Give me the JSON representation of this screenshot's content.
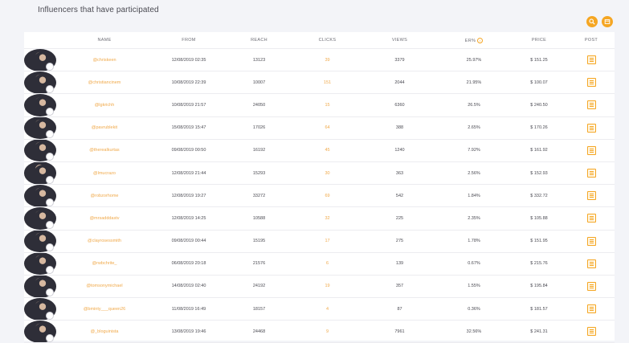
{
  "page": {
    "title": "Influencers that have participated"
  },
  "actions": {
    "search_icon": "search-icon",
    "export_icon": "export-icon"
  },
  "colors": {
    "accent": "#f5a623",
    "link": "#f0a94a",
    "background": "#f3f4f8"
  },
  "table": {
    "headers": {
      "name": "NAME",
      "from": "FROM",
      "reach": "REACH",
      "clicks": "CLICKS",
      "views": "VIEWS",
      "er": "ER%",
      "price": "PRICE",
      "post": "POST"
    },
    "rows": [
      {
        "handle": "@chriskeen",
        "from": "12/08/2019 02:35",
        "reach": "13123",
        "clicks": "39",
        "views": "3379",
        "er": "25.97%",
        "price": "$ 151.25"
      },
      {
        "handle": "@christiancinem",
        "from": "10/08/2019 22:39",
        "reach": "10007",
        "clicks": "151",
        "views": "2044",
        "er": "21.95%",
        "price": "$ 100.07"
      },
      {
        "handle": "@lgkrichh",
        "from": "10/08/2019 21:57",
        "reach": "24050",
        "clicks": "15",
        "views": "6360",
        "er": "26.5%",
        "price": "$ 240.50"
      },
      {
        "handle": "@pavrublekit",
        "from": "15/08/2019 15:47",
        "reach": "17026",
        "clicks": "64",
        "views": "388",
        "er": "2.65%",
        "price": "$ 170.26"
      },
      {
        "handle": "@therealkurtas",
        "from": "09/08/2019 00:50",
        "reach": "16192",
        "clicks": "45",
        "views": "1240",
        "er": "7.92%",
        "price": "$ 161.92"
      },
      {
        "handle": "@lmucrazo",
        "from": "12/08/2019 21:44",
        "reach": "15293",
        "clicks": "30",
        "views": "363",
        "er": "2.56%",
        "price": "$ 152.93"
      },
      {
        "handle": "@robzorhome",
        "from": "12/08/2019 19:27",
        "reach": "33272",
        "clicks": "69",
        "views": "542",
        "er": "1.84%",
        "price": "$ 332.72"
      },
      {
        "handle": "@mrsadddastv",
        "from": "12/08/2019 14:25",
        "reach": "10588",
        "clicks": "32",
        "views": "225",
        "er": "2.35%",
        "price": "$ 105.88"
      },
      {
        "handle": "@clayrosessmith",
        "from": "09/08/2019 00:44",
        "reach": "15195",
        "clicks": "17",
        "views": "275",
        "er": "1.78%",
        "price": "$ 151.95"
      },
      {
        "handle": "@rwbchrite_",
        "from": "06/08/2019 20:18",
        "reach": "21576",
        "clicks": "6",
        "views": "139",
        "er": "0.67%",
        "price": "$ 215.76"
      },
      {
        "handle": "@tomsonymichael",
        "from": "14/08/2019 02:40",
        "reach": "24192",
        "clicks": "19",
        "views": "357",
        "er": "1.55%",
        "price": "$ 195.84"
      },
      {
        "handle": "@bminty___queen26",
        "from": "11/08/2019 16:49",
        "reach": "18157",
        "clicks": "4",
        "views": "87",
        "er": "0.36%",
        "price": "$ 181.57"
      },
      {
        "handle": "@_bloguinista",
        "from": "13/08/2019 19:46",
        "reach": "24468",
        "clicks": "9",
        "views": "7961",
        "er": "32.56%",
        "price": "$ 241.31"
      }
    ]
  }
}
